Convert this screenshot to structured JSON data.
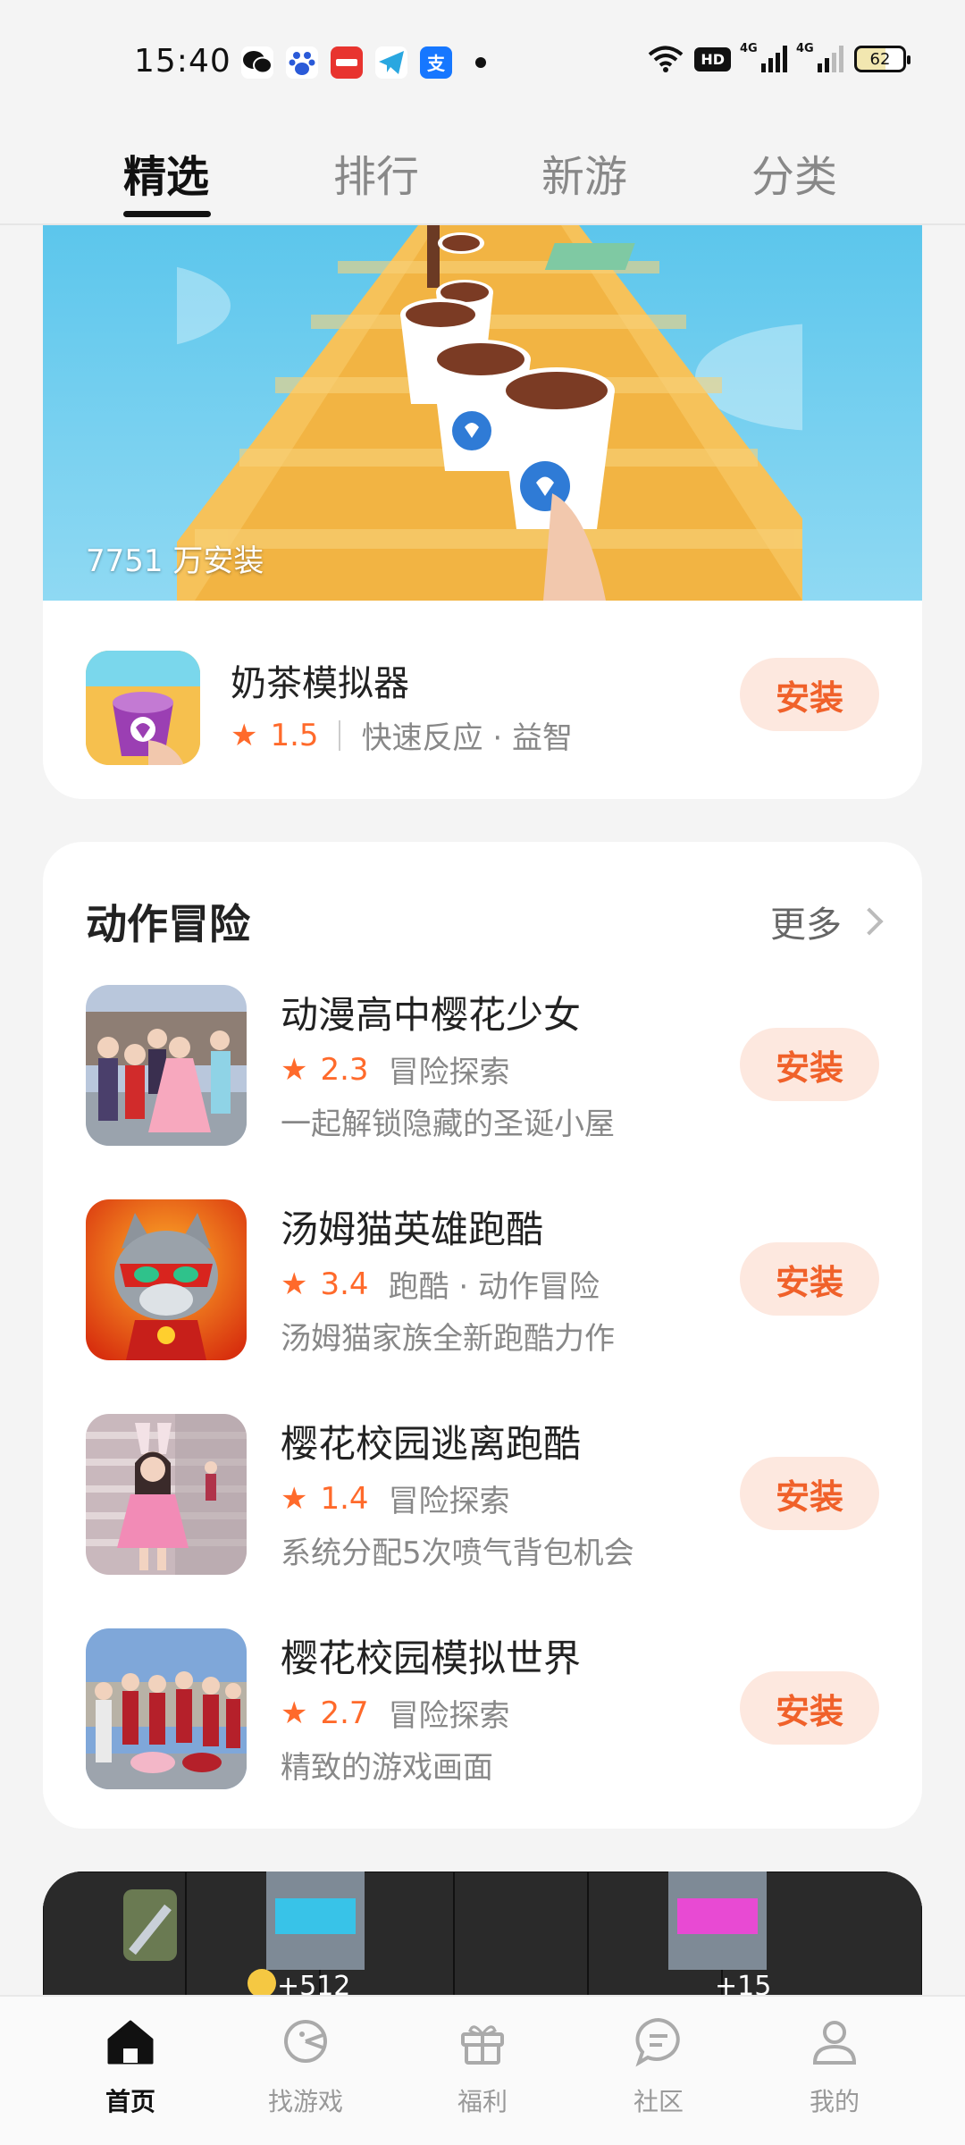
{
  "status_bar": {
    "time": "15:40",
    "hd_label": "HD",
    "network_1": "4G",
    "network_2": "4G",
    "battery": "62"
  },
  "top_tabs": [
    "精选",
    "排行",
    "新游",
    "分类"
  ],
  "featured": {
    "install_count": "7751 万安装",
    "name": "奶茶模拟器",
    "rating": "1.5",
    "tags": "快速反应 · 益智",
    "install_label": "安装"
  },
  "section": {
    "title": "动作冒险",
    "more_label": "更多",
    "games": [
      {
        "name": "动漫高中樱花少女",
        "rating": "2.3",
        "tags": "冒险探索",
        "desc": "一起解锁隐藏的圣诞小屋",
        "install_label": "安装"
      },
      {
        "name": "汤姆猫英雄跑酷",
        "rating": "3.4",
        "tags": "跑酷 · 动作冒险",
        "desc": "汤姆猫家族全新跑酷力作",
        "install_label": "安装"
      },
      {
        "name": "樱花校园逃离跑酷",
        "rating": "1.4",
        "tags": "冒险探索",
        "desc": "系统分配5次喷气背包机会",
        "install_label": "安装"
      },
      {
        "name": "樱花校园模拟世界",
        "rating": "2.7",
        "tags": "冒险探索",
        "desc": "精致的游戏画面",
        "install_label": "安装"
      }
    ]
  },
  "bottom_banner": {
    "left_value": "+512",
    "right_value": "+15"
  },
  "bottom_nav": [
    {
      "label": "首页",
      "icon": "home-icon"
    },
    {
      "label": "找游戏",
      "icon": "game-search-icon"
    },
    {
      "label": "福利",
      "icon": "gift-icon"
    },
    {
      "label": "社区",
      "icon": "chat-icon"
    },
    {
      "label": "我的",
      "icon": "profile-icon"
    }
  ],
  "colors": {
    "accent": "#f0612a",
    "install_bg": "#fde8df",
    "star": "#ff6a2b"
  }
}
